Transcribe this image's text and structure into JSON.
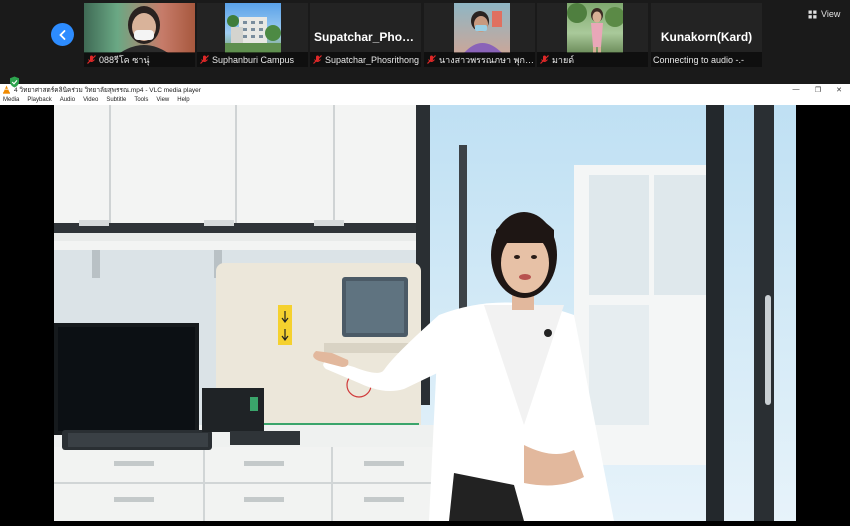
{
  "zoom": {
    "participants": [
      {
        "name": "088รีโค ซานุ่",
        "type": "video"
      },
      {
        "name": "Suphanburi Campus",
        "type": "video"
      },
      {
        "name": "Supatchar_Phosrithong",
        "display_title": "Supatchar_Phos...",
        "type": "name"
      },
      {
        "name": "นางสาวพรรณภษา พุกพัน...",
        "type": "video"
      },
      {
        "name": "มายด์",
        "type": "video"
      },
      {
        "name": "Connecting to audio -.-",
        "display_title": "Kunakorn(Kard)",
        "type": "name"
      }
    ],
    "view_label": "View"
  },
  "vlc": {
    "title": "4 วิทยาศาสตร์คลินิคร่วม วิทยาลัยสุพรรณ.mp4 - VLC media player",
    "menu": [
      "Media",
      "Playback",
      "Audio",
      "Video",
      "Subtitle",
      "Tools",
      "View",
      "Help"
    ],
    "window_controls": {
      "minimize": "—",
      "maximize": "❐",
      "close": "✕"
    }
  },
  "colors": {
    "zoom_bg": "#1a1a1a",
    "accent": "#2d8cff",
    "mute_red": "#e02828",
    "vlc_orange": "#f08a00"
  }
}
